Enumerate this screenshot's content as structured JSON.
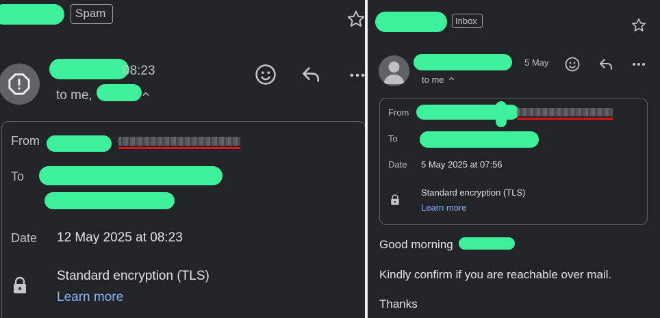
{
  "left": {
    "label_badge": "Spam",
    "time": "08:23",
    "to_line": "to me,",
    "details": {
      "from_label": "From",
      "to_label": "To",
      "date_label": "Date",
      "date_value": "12 May 2025 at 08:23",
      "encryption": "Standard encryption (TLS)",
      "learn_more": "Learn more"
    }
  },
  "right": {
    "label_badge": "Inbox",
    "date": "5 May",
    "to_line": "to me",
    "details": {
      "from_label": "From",
      "to_label": "To",
      "date_label": "Date",
      "date_value": "5 May 2025 at 07:56",
      "encryption": "Standard encryption (TLS)",
      "learn_more": "Learn more"
    },
    "body": {
      "greeting": "Good morning",
      "line1": "Kindly confirm if you are reachable over mail.",
      "line2": "Thanks"
    }
  },
  "icons": [
    "star-icon",
    "spam-warning-icon",
    "emoji-icon",
    "reply-icon",
    "more-icon",
    "chevron-up-icon",
    "lock-icon",
    "avatar-icon"
  ],
  "colors": {
    "background": "#232427",
    "link": "#8ab4f8",
    "redaction": "#3ef09c",
    "underline": "#e3101a"
  }
}
